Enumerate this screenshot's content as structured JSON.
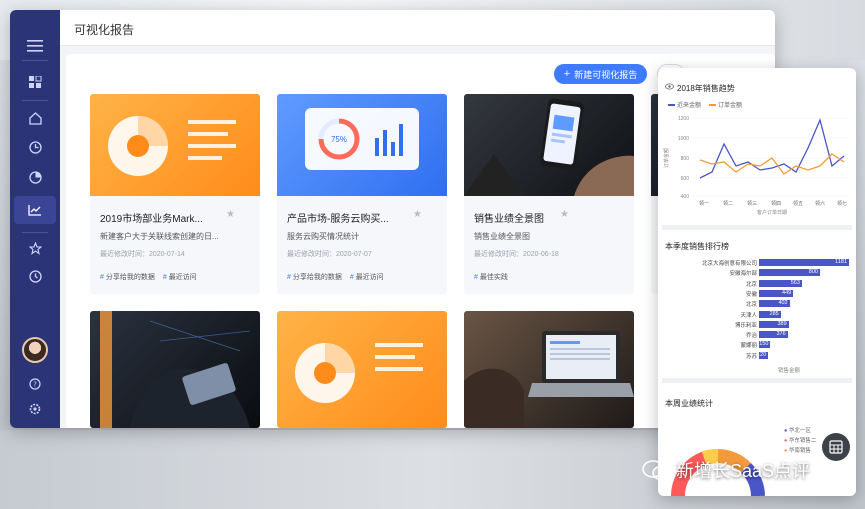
{
  "app": {
    "page_title": "可视化报告",
    "new_report_label": "新建可视化报告"
  },
  "sidebar": {
    "icons": [
      "menu-icon",
      "apps-icon",
      "home-icon",
      "clock-pie-icon",
      "pie-chart-icon",
      "line-chart-icon",
      "star-icon",
      "history-icon",
      "help-icon",
      "settings-icon"
    ]
  },
  "cards": [
    {
      "name": "2019市场部业务Mark...",
      "desc": "新建客户大于关联线索创建的日...",
      "date": "最近修改时间：2020-07-14",
      "tags": [
        "分享给我的数据",
        "最近访问"
      ],
      "thumb": "orange-pie"
    },
    {
      "name": "产品市场-服务云购买...",
      "desc": "服务云购买情况统计",
      "date": "最近修改时间：2020-07-07",
      "tags": [
        "分享给我的数据",
        "最近访问"
      ],
      "thumb": "blue-gauge",
      "gauge_value": "75%"
    },
    {
      "name": "销售业绩全景图",
      "desc": "销售业绩全景图",
      "date": "最近修改时间：2020-06-18",
      "tags": [
        "最佳实践"
      ],
      "thumb": "dark-phone"
    },
    {
      "thumb": "dark-tablet"
    },
    {
      "thumb": "orange-pie"
    },
    {
      "thumb": "photo-laptop"
    }
  ],
  "right_panel": {
    "trend": {
      "title": "2018年销售趋势",
      "legend": [
        "近来金额",
        "订单金额"
      ],
      "colors": {
        "series1": "#4a56c8",
        "series2": "#f39a3c"
      },
      "x_caption": "客户订单日期",
      "y_caption": "订单金额"
    },
    "ranking": {
      "title": "本季度销售排行榜",
      "x_caption": "销售金额",
      "rows": [
        {
          "label": "北京大海创意有限公司",
          "value": 1181
        },
        {
          "label": "安徽海尔部",
          "value": 800
        },
        {
          "label": "北京",
          "value": 563
        },
        {
          "label": "安徽",
          "value": 449
        },
        {
          "label": "北京",
          "value": 402
        },
        {
          "label": "天津人",
          "value": 285
        },
        {
          "label": "博乐利亚",
          "value": 389
        },
        {
          "label": "乔治",
          "value": 376
        },
        {
          "label": "蒙娜丽",
          "value": 150
        },
        {
          "label": "苏苏",
          "value": 120
        }
      ]
    },
    "weekly": {
      "title": "本周业绩统计",
      "legend": [
        "华北一区",
        "华东销售二",
        "华南销售"
      ]
    }
  },
  "watermark": "新增长SaaS点评"
}
